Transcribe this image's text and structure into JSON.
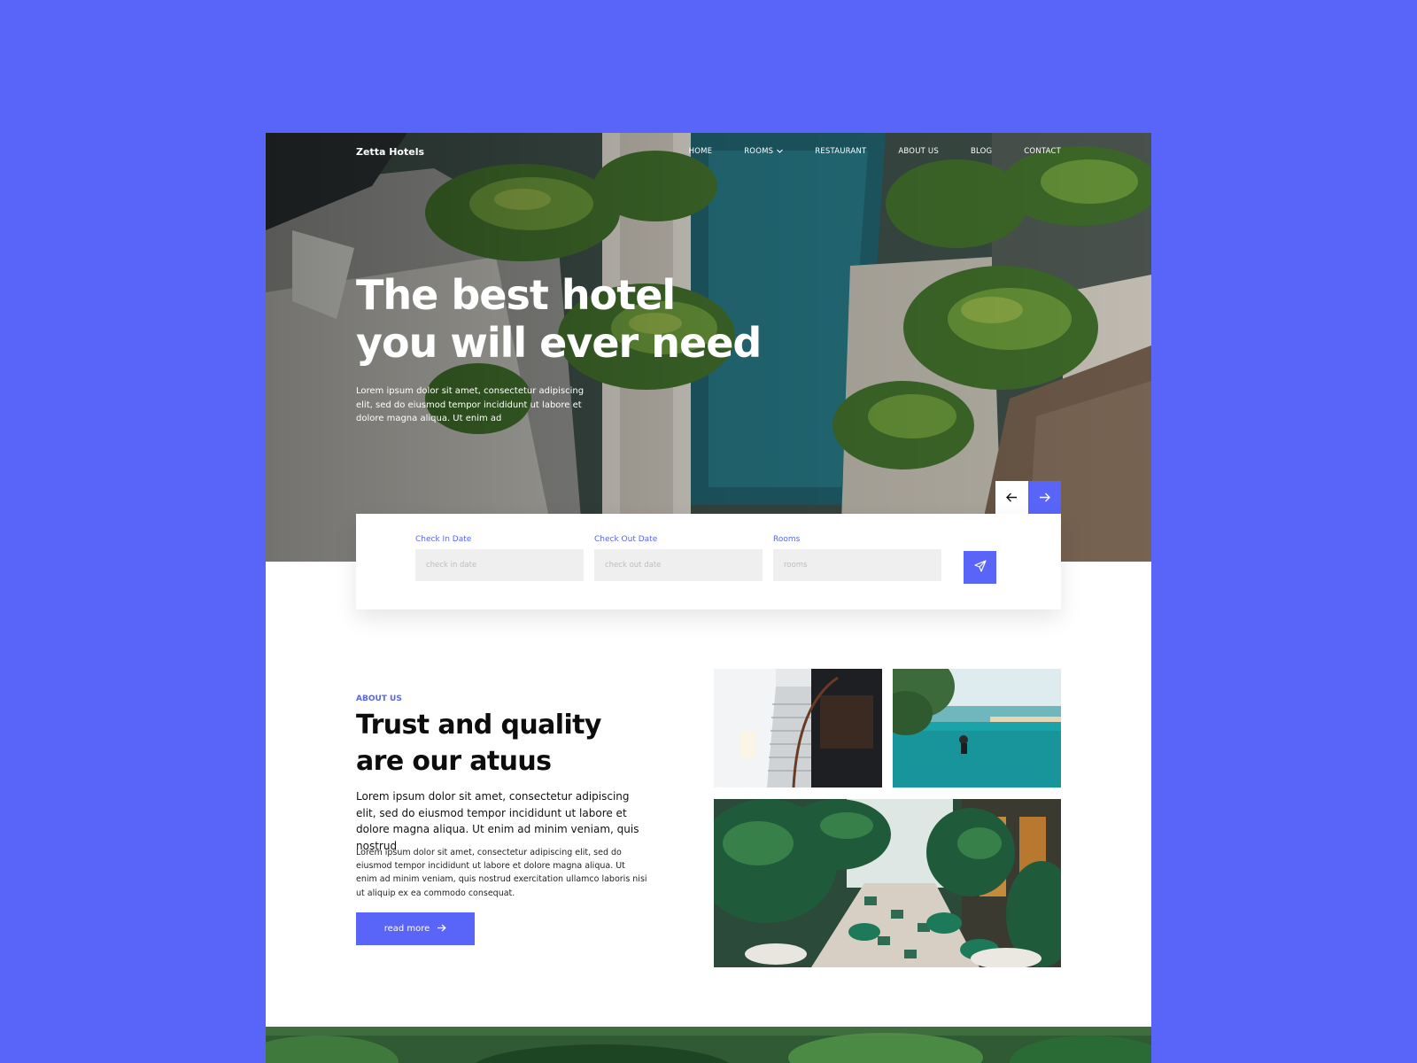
{
  "brand": "Zetta Hotels",
  "nav": {
    "items": [
      {
        "label": "HOME"
      },
      {
        "label": "ROOMS"
      },
      {
        "label": "RESTAURANT"
      },
      {
        "label": "ABOUT US"
      },
      {
        "label": "BLOG"
      },
      {
        "label": "CONTACT"
      }
    ]
  },
  "hero": {
    "title_line1": "The best hotel",
    "title_line2": "you will ever need",
    "text": "Lorem ipsum dolor sit amet, consectetur adipiscing elit, sed do eiusmod tempor incididunt ut labore et dolore magna aliqua. Ut enim ad"
  },
  "booking": {
    "checkin_label": "Check In Date",
    "checkin_placeholder": "check in date",
    "checkout_label": "Check Out Date",
    "checkout_placeholder": "check out date",
    "rooms_label": "Rooms",
    "rooms_placeholder": "rooms"
  },
  "about": {
    "eyebrow": "ABOUT US",
    "title_line1": "Trust and quality",
    "title_line2": "are our atuus",
    "lead": "Lorem ipsum dolor sit amet, consectetur adipiscing elit, sed do eiusmod tempor incididunt ut labore et dolore magna aliqua. Ut enim ad minim veniam, quis nostrud",
    "body": "Lorem ipsum dolor sit amet, consectetur adipiscing elit, sed do eiusmod tempor incididunt ut labore et dolore magna aliqua. Ut enim ad minim veniam, quis nostrud exercitation ullamco laboris nisi ut aliquip ex ea commodo consequat.",
    "button_label": "read more"
  },
  "icons": {
    "nav_dropdown": "chevron-down-icon",
    "prev": "arrow-left-icon",
    "next": "arrow-right-icon",
    "submit": "paper-plane-icon",
    "read_more": "arrow-right-icon"
  },
  "colors": {
    "accent": "#5964f9",
    "background": "#5964f9",
    "input_bg": "#efefef",
    "text_dark": "#0d0d0d"
  }
}
